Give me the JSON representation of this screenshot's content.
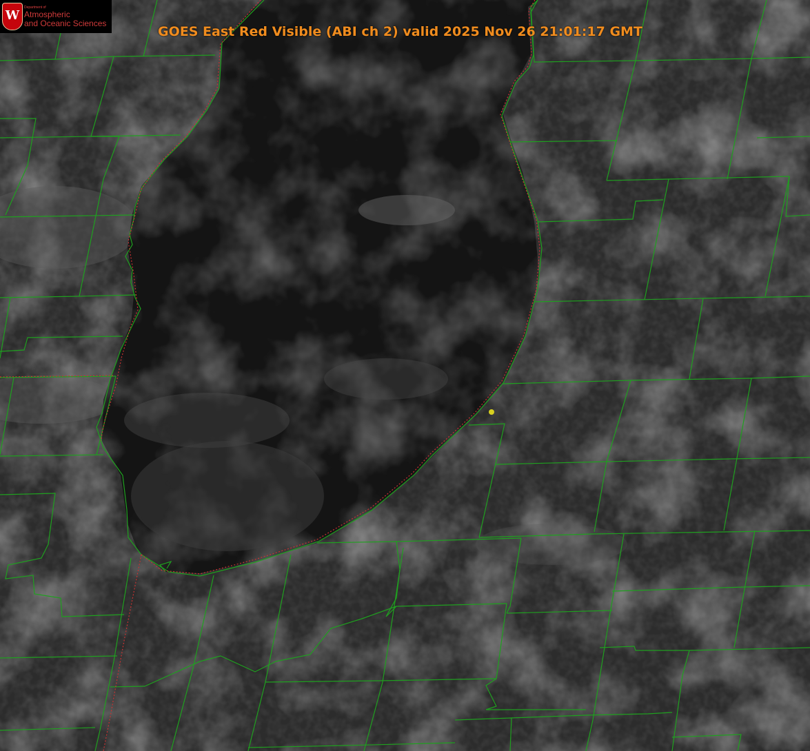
{
  "title": "GOES East Red Visible (ABI ch 2) valid 2025 Nov 26 21:01:17 GMT",
  "logo": {
    "crest_letter": "W",
    "department": "Department of",
    "line1": "Atmospheric",
    "line2": "and Oceanic Sciences"
  },
  "colors": {
    "county_lines": "#1fa01f",
    "state_lines": "#c83232",
    "title": "#f08c1e",
    "marker": "#d8d020"
  },
  "map": {
    "imagery": "satellite-visible-grayscale",
    "features": [
      "lake-michigan-shoreline",
      "county-boundaries",
      "state-boundary",
      "location-marker"
    ]
  }
}
